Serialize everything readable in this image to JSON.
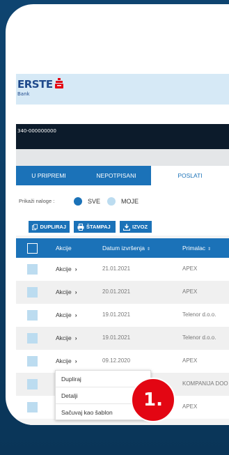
{
  "brand": {
    "name": "ERSTE",
    "sub": "Bank",
    "accent": "#e30613"
  },
  "account": {
    "number": "340-000000000"
  },
  "tabs": [
    {
      "label": "U PRIPREMI",
      "active": false
    },
    {
      "label": "NEPOTPISANI",
      "active": false
    },
    {
      "label": "POSLATI",
      "active": true
    }
  ],
  "filter": {
    "label": "Prikaži naloge :",
    "options": [
      {
        "label": "SVE",
        "selected": true
      },
      {
        "label": "MOJE",
        "selected": false
      }
    ]
  },
  "toolbar": {
    "duplicate_label": "DUPLIRAJ",
    "print_label": "ŠTAMPAJ",
    "export_label": "IZVOZ"
  },
  "table": {
    "headers": {
      "actions": "Akcije",
      "date": "Datum izvršenja",
      "recipient": "Primalac",
      "sort_glyph": "⇕"
    },
    "action_label": "Akcije",
    "rows": [
      {
        "date": "21.01.2021",
        "recipient": "APEX"
      },
      {
        "date": "20.01.2021",
        "recipient": "APEX"
      },
      {
        "date": "19.01.2021",
        "recipient": "Telenor d.o.o."
      },
      {
        "date": "19.01.2021",
        "recipient": "Telenor d.o.o."
      },
      {
        "date": "09.12.2020",
        "recipient": "APEX"
      },
      {
        "date": "",
        "recipient": "KOMPANIJA DOO"
      },
      {
        "date": "",
        "recipient": "APEX"
      }
    ]
  },
  "dropdown": {
    "items": [
      "Dupliraj",
      "Detalji",
      "Sačuvaj kao šablon"
    ]
  },
  "badge": {
    "text": "1."
  },
  "colors": {
    "primary": "#1b72b8",
    "frame": "#0d3f66",
    "checkbox": "#bcdcf0"
  }
}
